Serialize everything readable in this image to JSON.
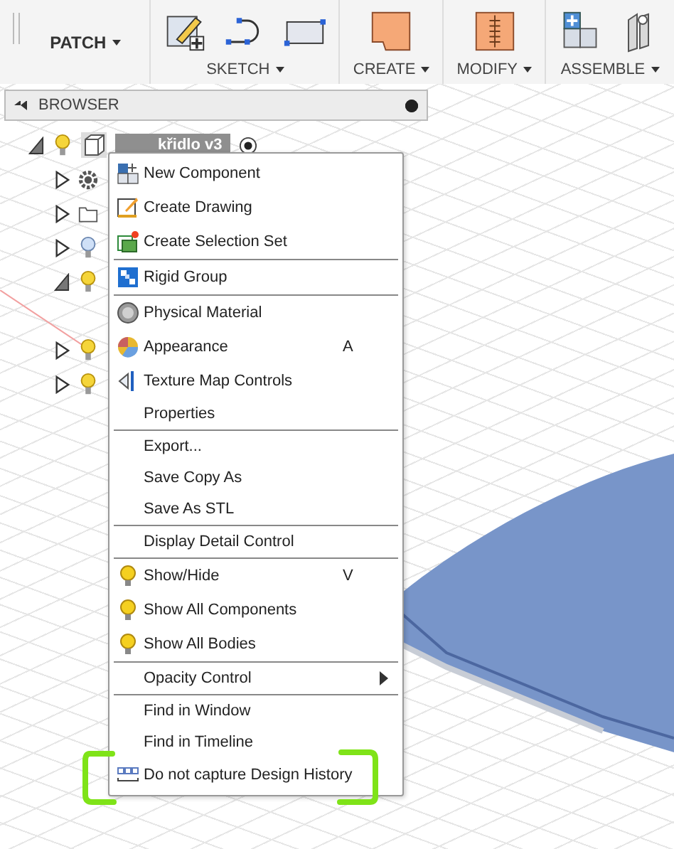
{
  "toolbar": {
    "workspace": "PATCH",
    "groups": [
      {
        "label": "SKETCH"
      },
      {
        "label": "CREATE"
      },
      {
        "label": "MODIFY"
      },
      {
        "label": "ASSEMBLE"
      }
    ]
  },
  "browser": {
    "title": "BROWSER"
  },
  "tree": [
    {
      "label": "křidlo v3",
      "selected": true,
      "expanded": true,
      "visible": true,
      "children": [
        {
          "kind": "settings",
          "expanded": false
        },
        {
          "kind": "folder",
          "expanded": false
        },
        {
          "kind": "bodies",
          "expanded": false,
          "visible": false
        },
        {
          "kind": "bodies",
          "expanded": true,
          "visible": true
        },
        {
          "kind": "gap"
        },
        {
          "kind": "bodies",
          "expanded": false,
          "visible": true
        },
        {
          "kind": "bodies",
          "expanded": false,
          "visible": true
        }
      ]
    }
  ],
  "context_menu": [
    {
      "label": "New Component"
    },
    {
      "label": "Create Drawing"
    },
    {
      "label": "Create Selection Set",
      "separator_after": true
    },
    {
      "label": "Rigid Group",
      "separator_after": true
    },
    {
      "label": "Physical Material"
    },
    {
      "label": "Appearance",
      "shortcut": "A"
    },
    {
      "label": "Texture Map Controls"
    },
    {
      "label": "Properties",
      "separator_after": true
    },
    {
      "label": "Export..."
    },
    {
      "label": "Save Copy As"
    },
    {
      "label": "Save As STL",
      "separator_after": true
    },
    {
      "label": "Display Detail Control",
      "separator_after": true
    },
    {
      "label": "Show/Hide",
      "shortcut": "V"
    },
    {
      "label": "Show All Components"
    },
    {
      "label": "Show All Bodies",
      "separator_after": true
    },
    {
      "label": "Opacity Control",
      "submenu": true,
      "separator_after": true
    },
    {
      "label": "Find in Window"
    },
    {
      "label": "Find in Timeline"
    },
    {
      "label": "Do not capture Design History"
    }
  ]
}
